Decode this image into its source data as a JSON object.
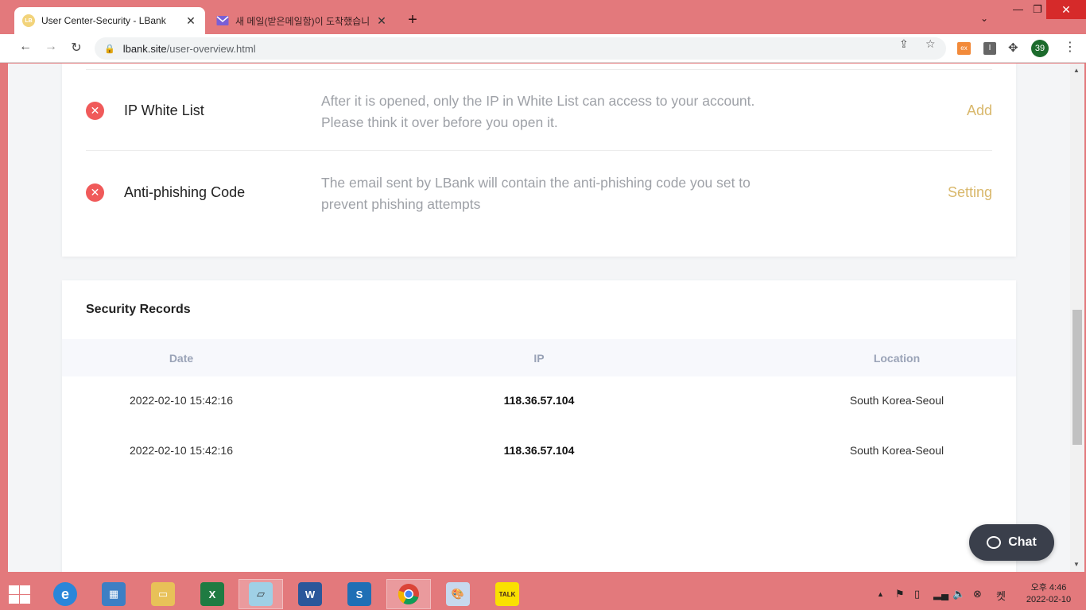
{
  "browser": {
    "tabs": [
      {
        "title": "User Center-Security - LBank",
        "favicon": "lbank-logo-icon"
      },
      {
        "title": "새 메일(받은메일함)이 도착했습니",
        "favicon": "mail-icon"
      }
    ],
    "url_host": "lbank.site",
    "url_path": "/user-overview.html",
    "extensions": {
      "ext1": "ex",
      "ext2": "I"
    },
    "profile_badge": "39"
  },
  "security_items": [
    {
      "name": "IP White List",
      "description": "After it is opened, only the IP in White List can access to your account. Please think it over before you open it.",
      "action": "Add",
      "status": "disabled"
    },
    {
      "name": "Anti-phishing Code",
      "description": "The email sent by LBank will contain the anti-phishing code you set to prevent phishing attempts",
      "action": "Setting",
      "status": "disabled"
    }
  ],
  "records": {
    "title": "Security Records",
    "columns": [
      "Date",
      "IP",
      "Location"
    ],
    "rows": [
      {
        "date": "2022-02-10 15:42:16",
        "ip": "118.36.57.104",
        "location": "South Korea-Seoul"
      },
      {
        "date": "2022-02-10 15:42:16",
        "ip": "118.36.57.104",
        "location": "South Korea-Seoul"
      }
    ]
  },
  "chat": {
    "label": "Chat"
  },
  "taskbar": {
    "apps": [
      "internet-explorer",
      "control-panel",
      "file-explorer",
      "excel",
      "notepad",
      "word",
      "app-s",
      "chrome",
      "paint",
      "kakaotalk"
    ],
    "kakao_label": "TALK",
    "clock_line1": "오후 4:46",
    "clock_line2": "2022-02-10",
    "ime_label": "켓"
  },
  "colors": {
    "accent": "#d9b86c",
    "error": "#f05a5a",
    "chrome_frame": "#e3797c"
  }
}
